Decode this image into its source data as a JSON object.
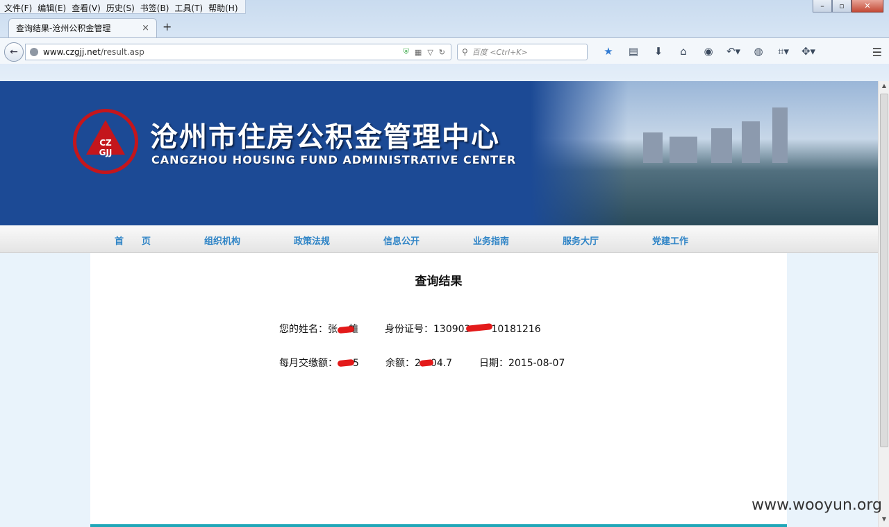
{
  "menubar": [
    "文件(F)",
    "编辑(E)",
    "查看(V)",
    "历史(S)",
    "书签(B)",
    "工具(T)",
    "帮助(H)"
  ],
  "tab": {
    "title": "查询结果-沧州公积金管理",
    "close": "×",
    "new": "+"
  },
  "address": {
    "host": "www.czgjj.net",
    "path": "/result.asp"
  },
  "search": {
    "placeholder": "百度 <Ctrl+K>"
  },
  "banner": {
    "title_cn": "沧州市住房公积金管理中心",
    "title_en": "CANGZHOU HOUSING FUND ADMINISTRATIVE CENTER",
    "logo_text": "CZ GJJ"
  },
  "nav": [
    "首　　页",
    "组织机构",
    "政策法规",
    "信息公开",
    "业务指南",
    "服务大厅",
    "党建工作"
  ],
  "result": {
    "title": "查询结果",
    "name_label": "您的姓名：张",
    "name_tail": "雄",
    "id_label": "身份证号：130903",
    "id_tail": "10181216",
    "monthly_label": "每月交缴额：",
    "monthly_tail": "5",
    "balance_label": "余额：2",
    "balance_tail": "04.7",
    "date_label": "日期：2015-08-07"
  },
  "watermark": "www.wooyun.org"
}
